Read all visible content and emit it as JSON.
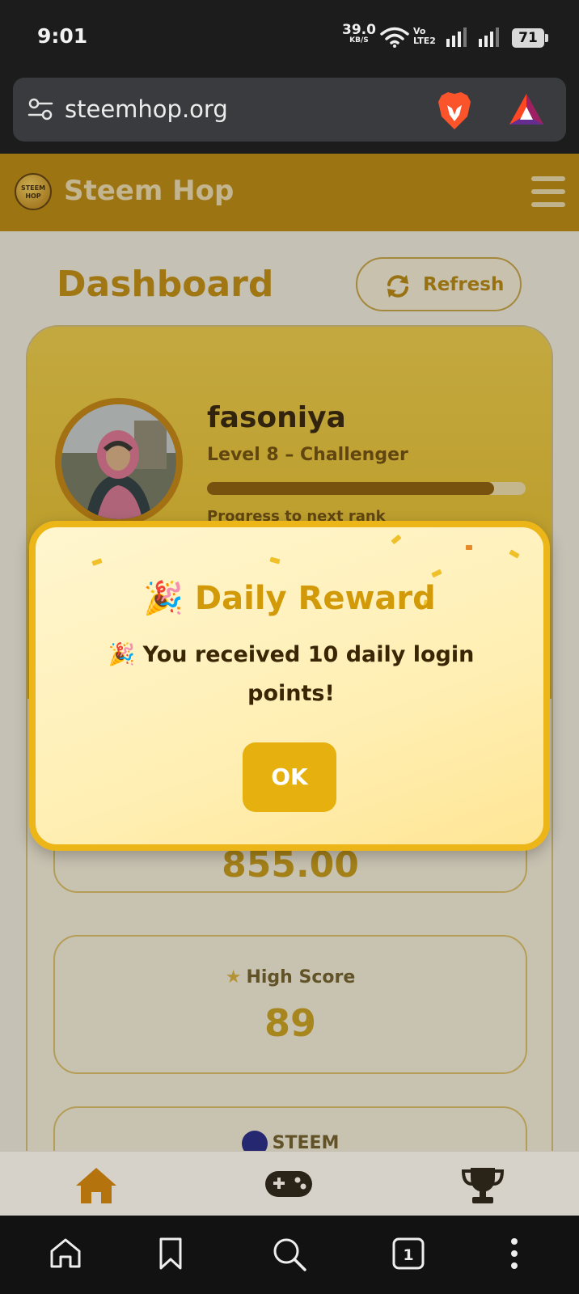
{
  "status_bar": {
    "time": "9:01",
    "net_speed": "39.0",
    "net_unit": "KB/S",
    "volte_line1": "Vo",
    "volte_line2": "LTE2",
    "battery": "71"
  },
  "browser": {
    "url": "steemhop.org"
  },
  "app": {
    "logo_line1": "STEEM",
    "logo_line2": "HOP",
    "title": "Steem Hop"
  },
  "dashboard": {
    "title": "Dashboard",
    "refresh_label": "Refresh"
  },
  "profile": {
    "username": "fasoniya",
    "level": "Level 8 – Challenger",
    "progress_fraction": 0.9,
    "progress_label": "Progress to next rank"
  },
  "stats": {
    "points_value": "855.00",
    "high_score_label": "High Score",
    "high_score_value": "89",
    "steem_label": "STEEM"
  },
  "modal": {
    "title": "🎉 Daily Reward",
    "message": "🎉 You received 10 daily login points!",
    "ok_label": "OK"
  },
  "colors": {
    "accent": "#c48e0c",
    "appbar": "#c08a0b",
    "modal_border": "#ecb518",
    "ok_button": "#e6b00e"
  },
  "icons": {
    "tune": "tune-icon",
    "brave": "brave-lion-icon",
    "bat": "bat-triangle-icon",
    "menu": "hamburger-menu-icon",
    "refresh": "refresh-icon",
    "home": "home-icon",
    "gamepad": "gamepad-icon",
    "trophy": "trophy-icon"
  }
}
